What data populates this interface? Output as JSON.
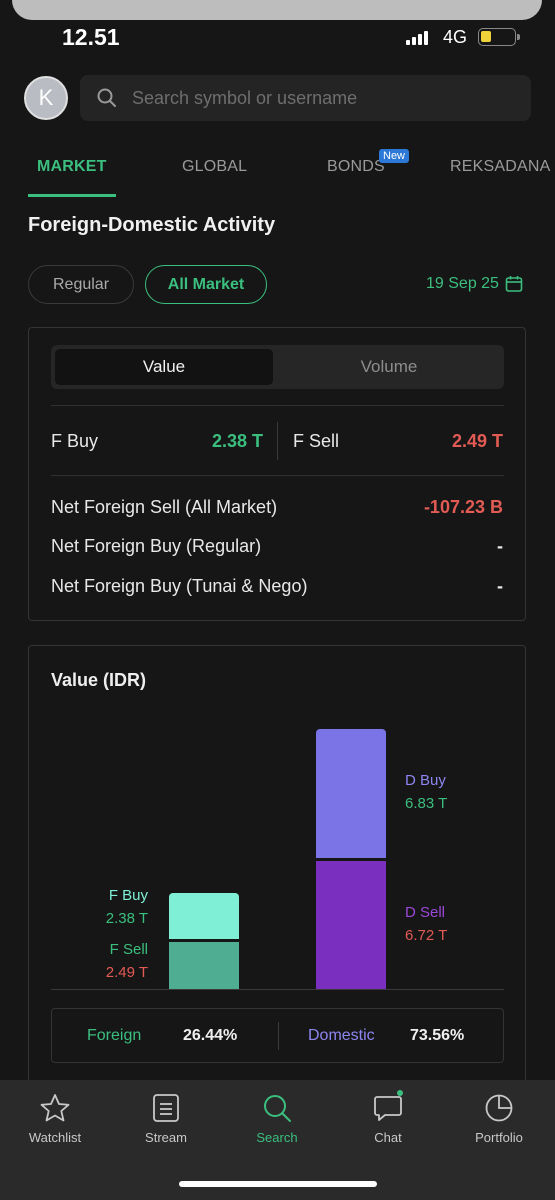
{
  "status_bar": {
    "time": "12.51",
    "network": "4G"
  },
  "header": {
    "avatar_letter": "K",
    "search_placeholder": "Search symbol or username"
  },
  "tabs": [
    {
      "label": "MARKET",
      "active": true
    },
    {
      "label": "GLOBAL",
      "active": false
    },
    {
      "label": "BONDS",
      "active": false,
      "badge": "New"
    },
    {
      "label": "REKSADANA",
      "active": false
    }
  ],
  "section_title": "Foreign-Domestic Activity",
  "filters": {
    "regular": "Regular",
    "all_market": "All Market",
    "selected": "All Market",
    "date": "19 Sep 25"
  },
  "summary": {
    "toggle": {
      "value": "Value",
      "volume": "Volume",
      "selected": "Value"
    },
    "f_buy_label": "F Buy",
    "f_buy_value": "2.38 T",
    "f_sell_label": "F Sell",
    "f_sell_value": "2.49 T",
    "rows": [
      {
        "label": "Net Foreign Sell (All Market)",
        "value": "-107.23 B"
      },
      {
        "label": "Net Foreign Buy (Regular)",
        "value": "-"
      },
      {
        "label": "Net Foreign Buy (Tunai & Nego)",
        "value": "-"
      }
    ]
  },
  "chart_card": {
    "title": "Value (IDR)",
    "foreign_label": "Foreign",
    "foreign_pct": "26.44%",
    "domestic_label": "Domestic",
    "domestic_pct": "73.56%"
  },
  "chart_data": {
    "type": "bar",
    "title": "Value (IDR)",
    "categories": [
      "Foreign",
      "Domestic"
    ],
    "series": [
      {
        "name": "F Buy",
        "values": [
          2.38,
          null
        ],
        "label": "2.38 T"
      },
      {
        "name": "F Sell",
        "values": [
          2.49,
          null
        ],
        "label": "2.49 T"
      },
      {
        "name": "D Buy",
        "values": [
          null,
          6.83
        ],
        "label": "6.83 T"
      },
      {
        "name": "D Sell",
        "values": [
          null,
          6.72
        ],
        "label": "6.72 T"
      }
    ],
    "colors": {
      "F Buy": "#7ff0d6",
      "F Sell": "#4fae92",
      "D Buy": "#7b74e6",
      "D Sell": "#7a2fbf"
    },
    "shares": {
      "Foreign": 26.44,
      "Domestic": 73.56
    },
    "units": "T (IDR)"
  },
  "bottom_nav": [
    {
      "label": "Watchlist",
      "icon": "star-icon",
      "active": false
    },
    {
      "label": "Stream",
      "icon": "stream-icon",
      "active": false
    },
    {
      "label": "Search",
      "icon": "search-icon",
      "active": true
    },
    {
      "label": "Chat",
      "icon": "chat-icon",
      "active": false
    },
    {
      "label": "Portfolio",
      "icon": "pie-chart-icon",
      "active": false
    }
  ],
  "colors": {
    "accent": "#3bbf7f",
    "negative": "#e25b54",
    "background": "#161616"
  }
}
